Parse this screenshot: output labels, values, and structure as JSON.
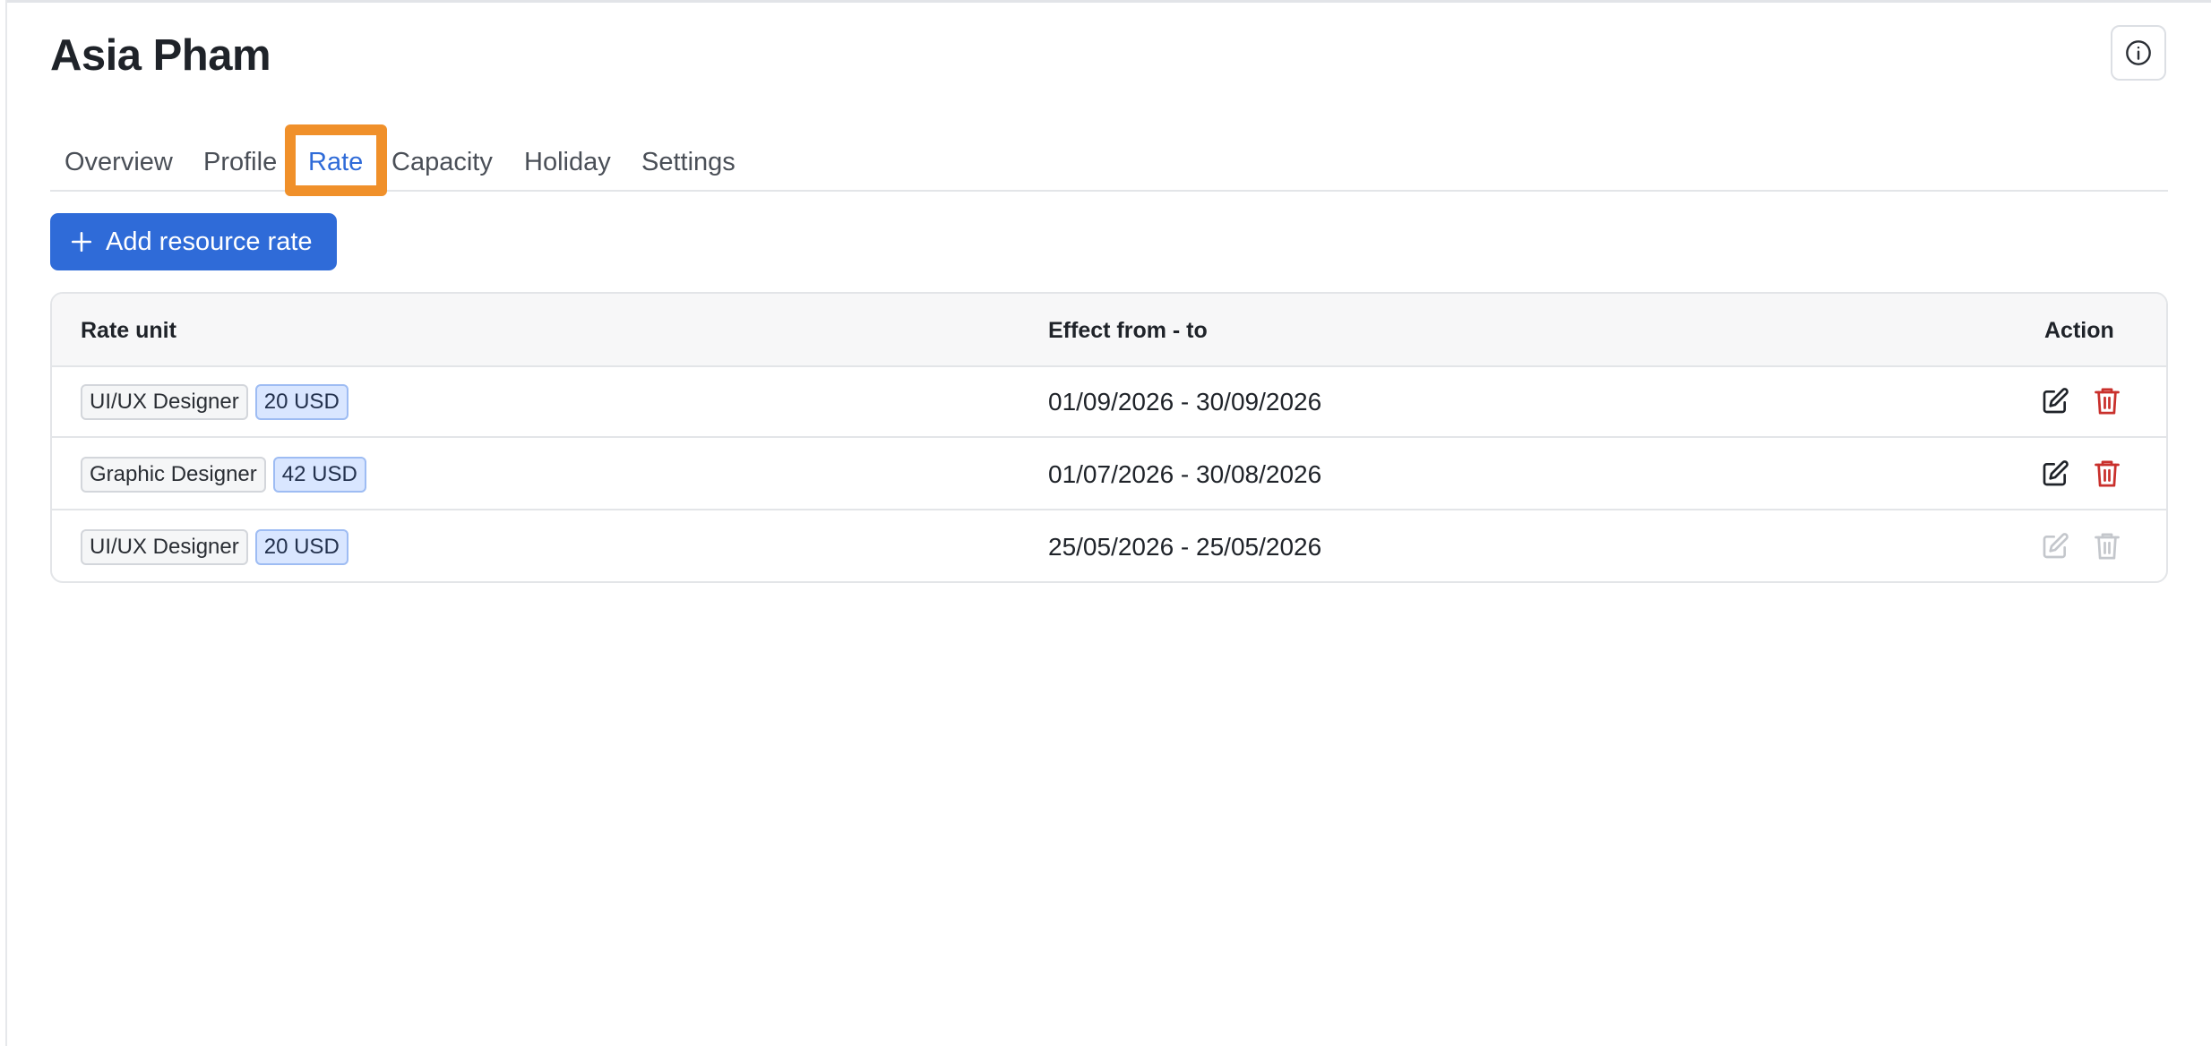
{
  "page": {
    "title": "Asia Pham"
  },
  "tabs": [
    {
      "label": "Overview",
      "active": false
    },
    {
      "label": "Profile",
      "active": false
    },
    {
      "label": "Rate",
      "active": true
    },
    {
      "label": "Capacity",
      "active": false
    },
    {
      "label": "Holiday",
      "active": false
    },
    {
      "label": "Settings",
      "active": false
    }
  ],
  "toolbar": {
    "add_label": "Add resource rate",
    "add_icon": "plus-icon"
  },
  "info_icon": "info-circle-icon",
  "table": {
    "headers": {
      "rate_unit": "Rate unit",
      "period": "Effect from - to",
      "action": "Action"
    },
    "rows": [
      {
        "role": "UI/UX Designer",
        "rate": "20 USD",
        "period": "01/09/2026 - 30/09/2026",
        "actions_enabled": true
      },
      {
        "role": "Graphic Designer",
        "rate": "42 USD",
        "period": "01/07/2026 - 30/08/2026",
        "actions_enabled": true
      },
      {
        "role": "UI/UX Designer",
        "rate": "20 USD",
        "period": "25/05/2026 - 25/05/2026",
        "actions_enabled": false
      }
    ]
  },
  "colors": {
    "accent": "#2f6bd8",
    "highlight": "#f0902a",
    "delete": "#c9302c",
    "disabled": "#c4c7cc"
  }
}
